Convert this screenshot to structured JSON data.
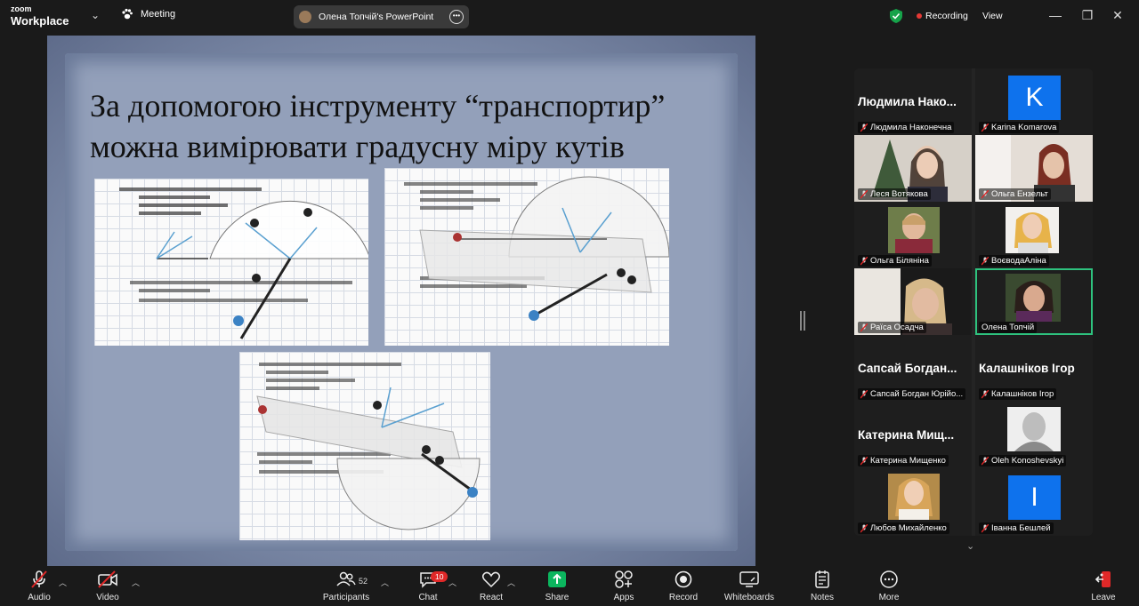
{
  "app": {
    "logo_top": "zoom",
    "logo_bottom": "Workplace",
    "meeting_label": "Meeting"
  },
  "share": {
    "title": "Олена Топчій's PowerPoint"
  },
  "status": {
    "recording": "Recording",
    "view": "View"
  },
  "slide": {
    "title_line1": "За допомогою інструменту “транспортир”",
    "title_line2": "можна вимірювати градусну міру кутів"
  },
  "gallery": {
    "tiles": [
      {
        "name": "Людмила Наконечна",
        "big": "Людмила  Нако..."
      },
      {
        "name": "Karina Komarova",
        "initial": "K"
      },
      {
        "name": "Леся Вотякова"
      },
      {
        "name": "Ольга Ензельт"
      },
      {
        "name": "Ольга Біляніна"
      },
      {
        "name": "ВоєводаАліна"
      },
      {
        "name": "Раїса Осадча"
      },
      {
        "name": "Олена Топчій"
      },
      {
        "name": "Сапсай Богдан Юрійо...",
        "big": "Сапсай  Богдан..."
      },
      {
        "name": "Калашніков Ігор",
        "big": "Калашніков Ігор"
      },
      {
        "name": "Катерина Мищенко",
        "big": "Катерина  Мищ..."
      },
      {
        "name": "Oleh Konoshevskyi"
      },
      {
        "name": "Любов Михайленко"
      },
      {
        "name": "Іванна Бешлей",
        "initial": "І"
      }
    ]
  },
  "toolbar": {
    "audio": "Audio",
    "video": "Video",
    "participants": "Participants",
    "participants_count": "52",
    "chat": "Chat",
    "chat_badge": "10",
    "react": "React",
    "share": "Share",
    "apps": "Apps",
    "record": "Record",
    "whiteboards": "Whiteboards",
    "notes": "Notes",
    "more": "More",
    "leave": "Leave"
  },
  "colors": {
    "accent_green": "#2ec27e",
    "share_green": "#0bb65e",
    "leave_red": "#e02828",
    "avatar_blue": "#0e72ed"
  }
}
